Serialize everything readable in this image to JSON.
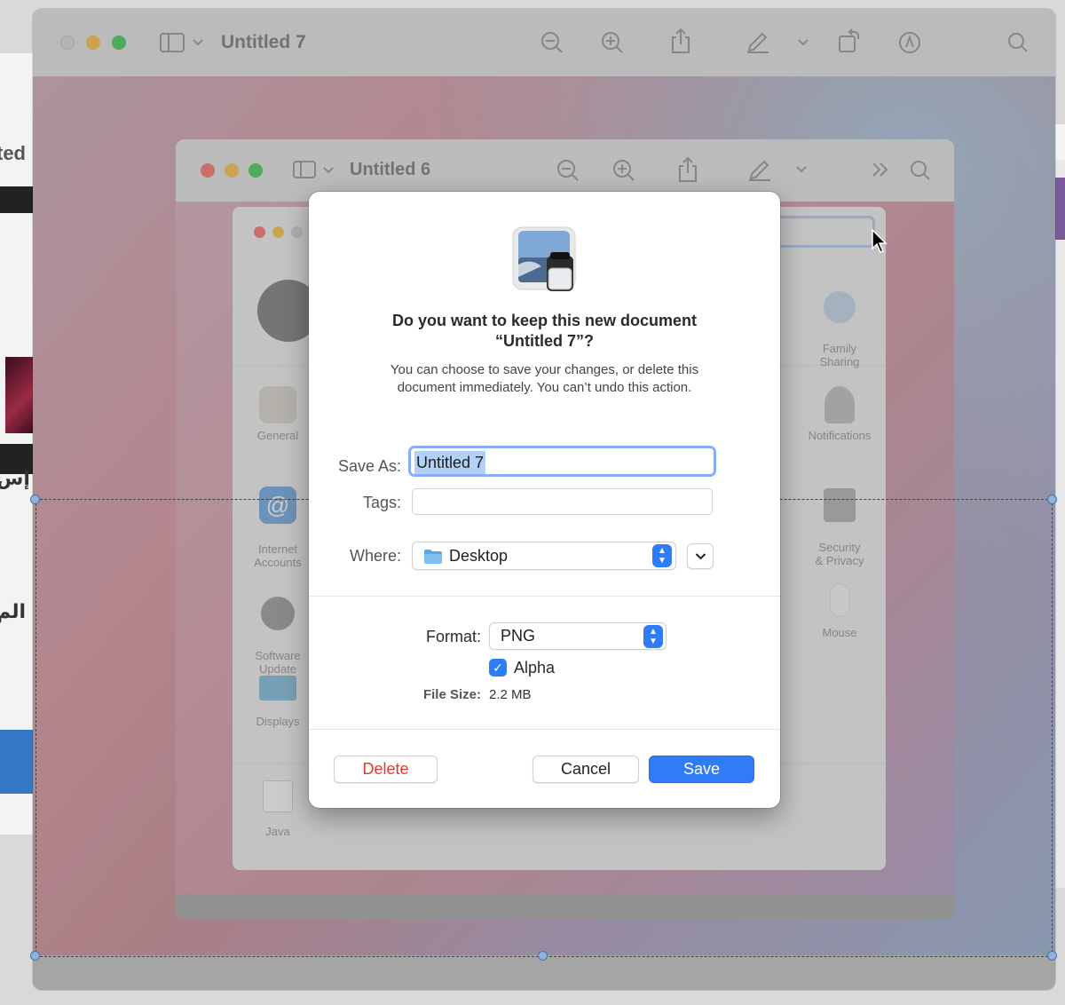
{
  "background": {
    "left_text_1": "ted",
    "left_text_2": "إس",
    "left_text_3": "الم"
  },
  "window_outer": {
    "title": "Untitled 7"
  },
  "window_middle": {
    "title": "Untitled 6"
  },
  "prefs": {
    "items": [
      {
        "label": "General"
      },
      {
        "label": "Internet\nAccounts"
      },
      {
        "label": "Software\nUpdate"
      },
      {
        "label": "Displays"
      },
      {
        "label": "Java"
      },
      {
        "label": "Family\nSharing"
      },
      {
        "label": "Notifications"
      },
      {
        "label": "Security\n& Privacy"
      },
      {
        "label": "Mouse"
      }
    ]
  },
  "dialog": {
    "title_line1": "Do you want to keep this new document",
    "title_line2": "“Untitled 7”?",
    "message_line1": "You can choose to save your changes, or delete this",
    "message_line2": "document immediately. You can’t undo this action.",
    "save_as_label": "Save As:",
    "save_as_value": "Untitled 7",
    "tags_label": "Tags:",
    "tags_value": "",
    "where_label": "Where:",
    "where_value": "Desktop",
    "format_label": "Format:",
    "format_value": "PNG",
    "alpha_label": "Alpha",
    "alpha_checked": true,
    "file_size_label": "File Size:",
    "file_size_value": "2.2 MB",
    "delete_label": "Delete",
    "cancel_label": "Cancel",
    "save_label": "Save"
  },
  "colors": {
    "accent": "#2f7cf6",
    "delete": "#e2382f",
    "close": "#ff5f57",
    "minimize": "#febc2e",
    "zoom": "#28c840"
  }
}
